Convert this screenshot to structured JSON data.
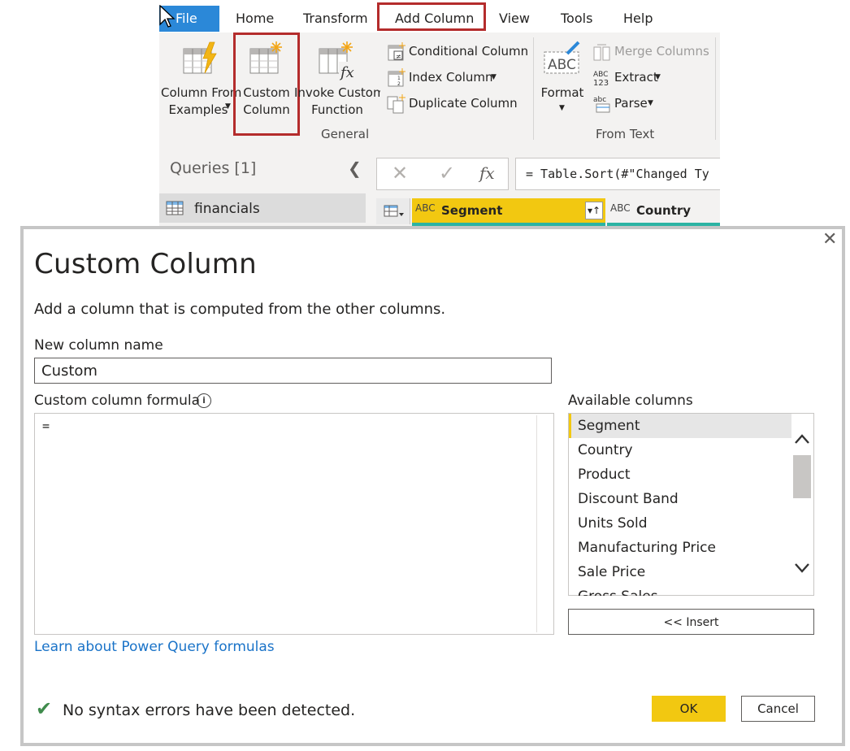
{
  "ribbon": {
    "tabs": [
      "File",
      "Home",
      "Transform",
      "Add Column",
      "View",
      "Tools",
      "Help"
    ],
    "general": {
      "column_from_examples": [
        "Column From",
        "Examples"
      ],
      "custom_column": [
        "Custom",
        "Column"
      ],
      "invoke_custom_function": [
        "Invoke Custom",
        "Function"
      ],
      "conditional_column": "Conditional Column",
      "index_column": "Index Column",
      "duplicate_column": "Duplicate Column",
      "group_label": "General"
    },
    "from_text": {
      "format": "Format",
      "merge_columns": "Merge Columns",
      "extract": "Extract",
      "parse": "Parse",
      "group_label": "From Text"
    }
  },
  "queries": {
    "title": "Queries [1]",
    "items": [
      "financials"
    ]
  },
  "formula_bar": {
    "fx": "fx",
    "text": "= Table.Sort(#\"Changed Ty"
  },
  "grid": {
    "columns": [
      {
        "type": "ABC",
        "name": "Segment"
      },
      {
        "type": "ABC",
        "name": "Country"
      }
    ]
  },
  "dialog": {
    "title": "Custom Column",
    "description": "Add a column that is computed from the other columns.",
    "new_column_label": "New column name",
    "new_column_value": "Custom",
    "formula_label": "Custom column formula",
    "formula_value": "=",
    "learn_link": "Learn about Power Query formulas",
    "available_label": "Available columns",
    "available_columns": [
      "Segment",
      "Country",
      "Product",
      "Discount Band",
      "Units Sold",
      "Manufacturing Price",
      "Sale Price",
      "Gross Sales"
    ],
    "insert_button": "<< Insert",
    "status": "No syntax errors have been detected.",
    "ok_button": "OK",
    "cancel_button": "Cancel"
  },
  "colors": {
    "accent_yellow": "#f2c811",
    "file_tab_blue": "#2b88d8",
    "highlight_red": "#b42c2c",
    "link_blue": "#1a73c8",
    "ok_green": "#3f8b4c"
  }
}
